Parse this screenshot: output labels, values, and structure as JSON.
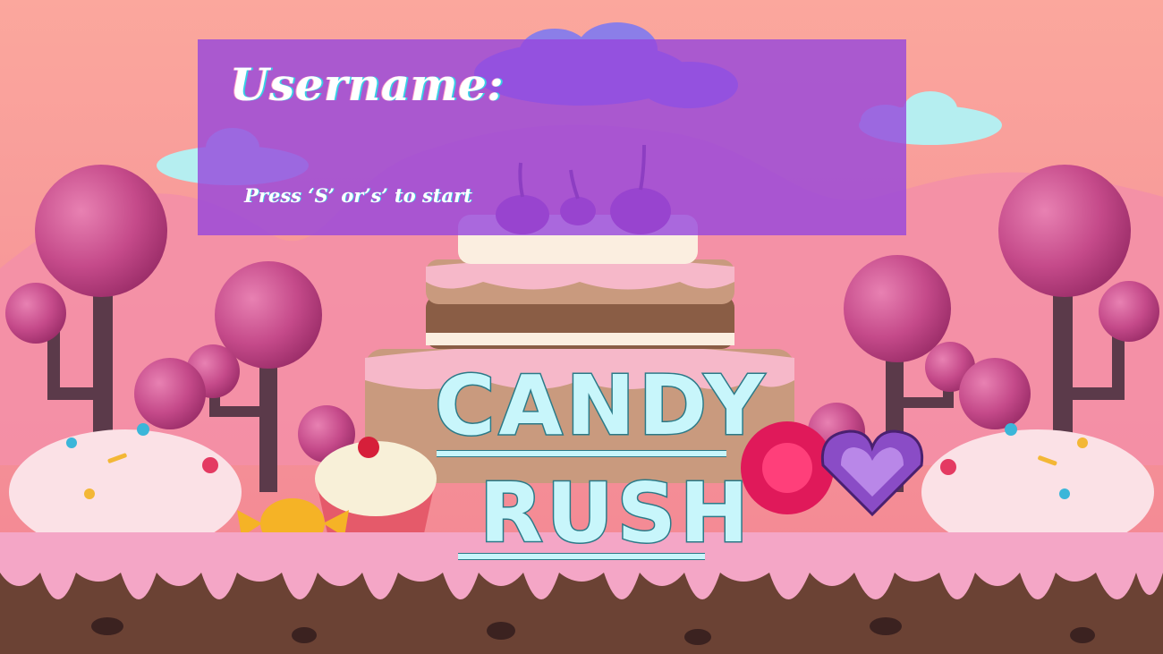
{
  "start_screen": {
    "username_label": "Username:",
    "username_value": "",
    "start_hint": "Press ‘S’ or’s’ to start"
  },
  "logo": {
    "line1": "CANDY",
    "line2": "RUSH"
  },
  "colors": {
    "sky": "#f6a09a",
    "panel": "#9646dc",
    "logo_fill": "#c8f6fb",
    "logo_outline": "#2b7a88",
    "frosting": "#f4a6c6",
    "ground": "#6b4234",
    "tree_top": "#c54a8a",
    "tree_trunk": "#5b3a4a"
  },
  "decorations": [
    "cake-icon",
    "cupcake-icon",
    "wrapped-candy-icon",
    "round-candy-icon",
    "heart-gem-icon",
    "lollipop-tree-icon",
    "cloud-icon",
    "cherry-icon"
  ]
}
